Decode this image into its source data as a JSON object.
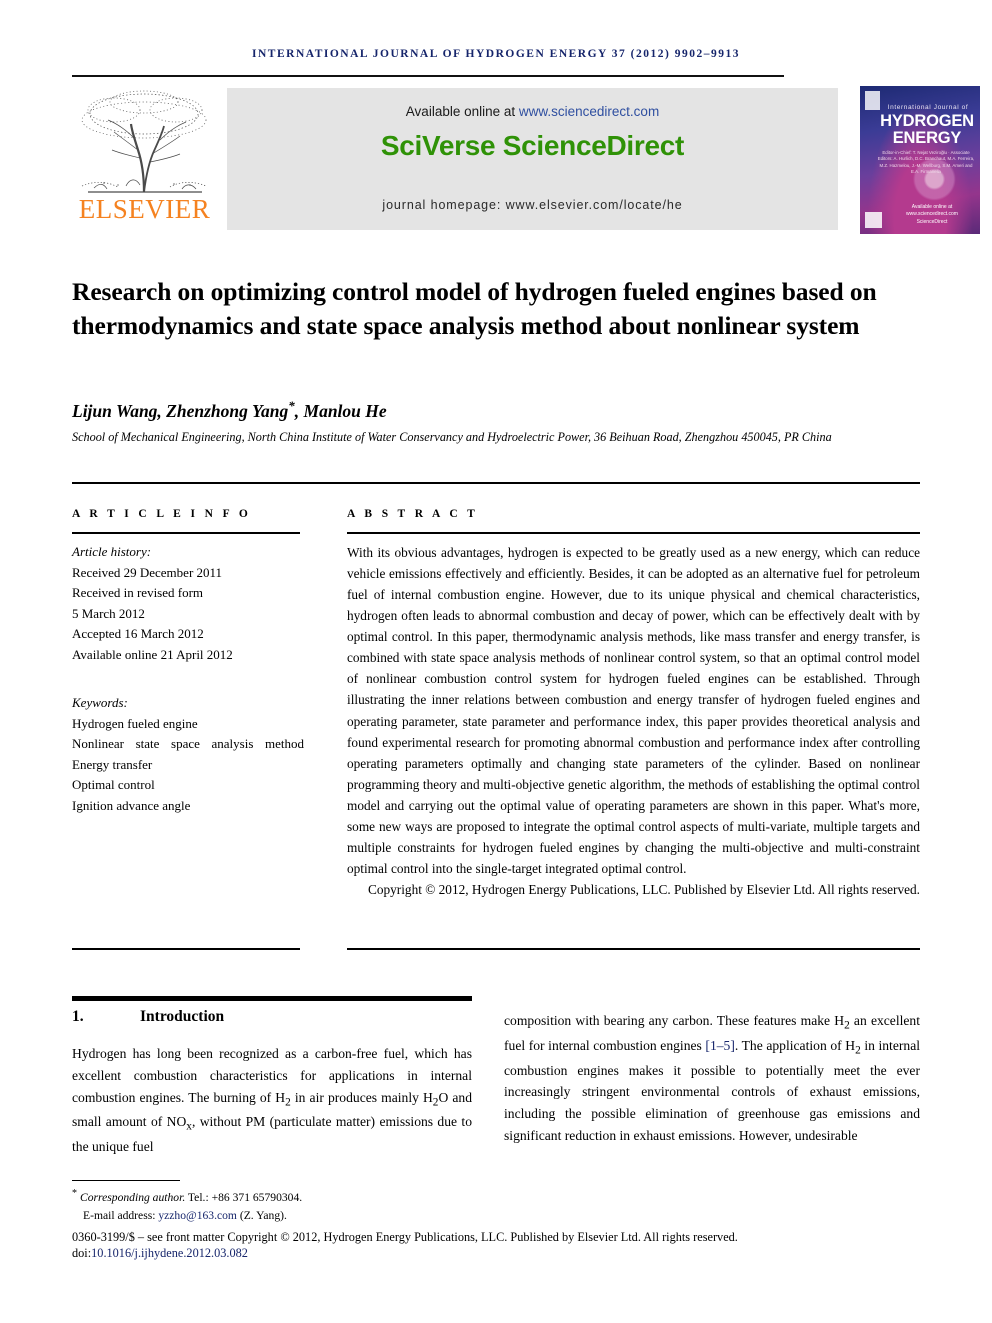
{
  "running_head": "INTERNATIONAL JOURNAL OF HYDROGEN ENERGY 37 (2012) 9902–9913",
  "masthead": {
    "publisher": "ELSEVIER",
    "available_prefix": "Available online at ",
    "available_url": "www.sciencedirect.com",
    "platform_logo": "SciVerse ScienceDirect",
    "homepage": "journal homepage: www.elsevier.com/locate/he",
    "cover": {
      "line_small": "International Journal of",
      "line_hydrogen": "HYDROGEN",
      "line_energy": "ENERGY",
      "editors": "Editor-in-Chief: T. Nejat Veziroğlu  ·  Associate Editors: A. Hurlich, D.C. Branchaut, M.A. Ferreira, M.Z. Hazmelou, J.-M. Wellburg, S.M. Ameri and E.A. Firmanella",
      "sciencedirect": "Available online at www.sciencedirect.com  ScienceDirect"
    }
  },
  "title": "Research on optimizing control model of hydrogen fueled engines based on thermodynamics and state space analysis method about nonlinear system",
  "authors": {
    "names_before_star": "Lijun Wang, Zhenzhong Yang",
    "star": "*",
    "names_after_star": ", Manlou He",
    "affiliation": "School of Mechanical Engineering, North China Institute of Water Conservancy and Hydroelectric Power, 36 Beihuan Road, Zhengzhou 450045, PR China"
  },
  "sections": {
    "article_info_label": "A R T I C L E   I N F O",
    "abstract_label": "A B S T R A C T"
  },
  "article_info": {
    "history_title": "Article history:",
    "history": [
      "Received 29 December 2011",
      "Received in revised form",
      "5 March 2012",
      "Accepted 16 March 2012",
      "Available online 21 April 2012"
    ],
    "keywords_title": "Keywords:",
    "keywords": [
      "Hydrogen fueled engine",
      "Nonlinear state space analysis method",
      "Energy transfer",
      "Optimal control",
      "Ignition advance angle"
    ]
  },
  "abstract": {
    "body": "With its obvious advantages, hydrogen is expected to be greatly used as a new energy, which can reduce vehicle emissions effectively and efficiently. Besides, it can be adopted as an alternative fuel for petroleum fuel of internal combustion engine. However, due to its unique physical and chemical characteristics, hydrogen often leads to abnormal combustion and decay of power, which can be effectively dealt with by optimal control. In this paper, thermodynamic analysis methods, like mass transfer and energy transfer, is combined with state space analysis methods of nonlinear control system, so that an optimal control model of nonlinear combustion control system for hydrogen fueled engines can be established. Through illustrating the inner relations between combustion and energy transfer of hydrogen fueled engines and operating parameter, state parameter and performance index, this paper provides theoretical analysis and found experimental research for promoting abnormal combustion and performance index after controlling operating parameters optimally and changing state parameters of the cylinder. Based on nonlinear programming theory and multi-objective genetic algorithm, the methods of establishing the optimal control model and carrying out the optimal value of operating parameters are shown in this paper. What's more, some new ways are proposed to integrate the optimal control aspects of multi-variate, multiple targets and multiple constraints for hydrogen fueled engines by changing the multi-objective and multi-constraint optimal control into the single-target integrated optimal control.",
    "copyright": "Copyright © 2012, Hydrogen Energy Publications, LLC. Published by Elsevier Ltd. All rights reserved."
  },
  "introduction": {
    "number": "1.",
    "heading": "Introduction",
    "col_left_1": "Hydrogen has long been recognized as a carbon-free fuel, which has excellent combustion characteristics for applications in internal combustion engines. The burning of H",
    "col_left_sub1": "2",
    "col_left_2": " in air produces mainly H",
    "col_left_sub2": "2",
    "col_left_3": "O and small amount of NO",
    "col_left_sub3": "x",
    "col_left_4": ", without PM (particulate matter) emissions due to the unique fuel",
    "col_right_1": "composition with bearing any carbon. These features make H",
    "col_right_sub1": "2",
    "col_right_2": " an excellent fuel for internal combustion engines ",
    "col_right_ref": "[1–5]",
    "col_right_3": ". The application of H",
    "col_right_sub2": "2",
    "col_right_4": " in internal combustion engines makes it possible to potentially meet the ever increasingly stringent environmental controls of exhaust emissions, including the possible elimination of greenhouse gas emissions and significant reduction in exhaust emissions. However, undesirable"
  },
  "footer": {
    "corresponding_label": "Corresponding author.",
    "tel": " Tel.: +86 371 65790304.",
    "email_label": "E-mail address: ",
    "email": "yzzho@163.com",
    "email_suffix": " (Z. Yang).",
    "issn_line": "0360-3199/$ – see front matter Copyright © 2012, Hydrogen Energy Publications, LLC. Published by Elsevier Ltd. All rights reserved.",
    "doi_prefix": "doi:",
    "doi": "10.1016/j.ijhydene.2012.03.082"
  },
  "colors": {
    "elsevier_orange": "#f58220",
    "sciencedirect_green": "#2f9207",
    "link_blue": "#2f4fa0",
    "navy": "#16256b",
    "banner_gray": "#e4e4e4"
  }
}
